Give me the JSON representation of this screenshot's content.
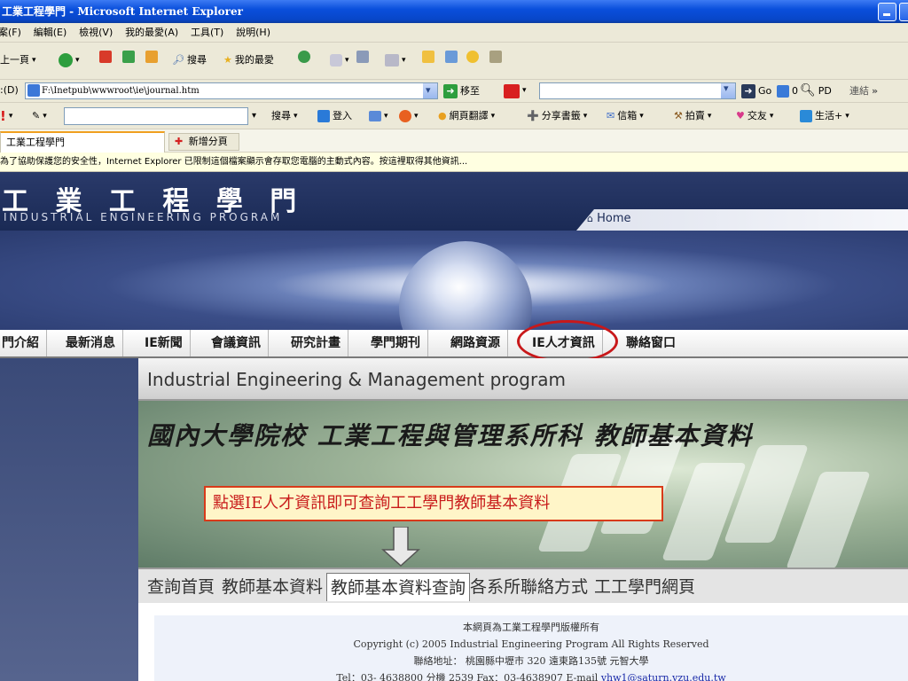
{
  "window": {
    "title": "工業工程學門 - Microsoft Internet Explorer"
  },
  "menu": [
    "案(F)",
    "編輯(E)",
    "檢視(V)",
    "我的最愛(A)",
    "工具(T)",
    "說明(H)"
  ],
  "toolbar": {
    "back": "上一頁",
    "search": "搜尋",
    "favorites": "我的最愛"
  },
  "address": {
    "label": ":(D)",
    "url": "F:\\Inetpub\\wwwroot\\ie\\journal.htm",
    "go": "移至",
    "go2": "Go",
    "count": "0",
    "pd": "PD",
    "links": "連結"
  },
  "yahoo_toolbar": {
    "search_btn": "搜尋",
    "login": "登入",
    "translate": "網頁翻譯",
    "bookmarks": "分享書籤",
    "mail": "信箱",
    "auction": "拍賣",
    "friends": "交友",
    "life": "生活+"
  },
  "tabs": {
    "active": "工業工程學門",
    "new_tab": "新增分頁"
  },
  "infobar": "為了協助保護您的安全性，Internet Explorer 已限制這個檔案顯示會存取您電腦的主動式內容。按這裡取得其他資訊...",
  "site": {
    "title": "工 業 工 程 學 門",
    "subtitle": "INDUSTRIAL ENGINEERING PROGRAM",
    "home": "Home"
  },
  "nav": [
    "門介紹",
    "最新消息",
    "IE新聞",
    "會議資訊",
    "研究計畫",
    "學門期刊",
    "網路資源",
    "IE人才資訊",
    "聯絡窗口"
  ],
  "content": {
    "heading": "Industrial Engineering & Management program",
    "hero_title": "國內大學院校 工業工程與管理系所科 教師基本資料",
    "callout": "點選IE人才資訊即可查詢工工學門教師基本資料",
    "subnav": [
      "查詢首頁",
      "教師基本資料",
      "教師基本資料查詢",
      "各系所聯絡方式",
      "工工學門網頁"
    ]
  },
  "footer": {
    "line1": "本網頁為工業工程學門版權所有",
    "line2": "Copyright (c) 2005 Industrial Engineering Program All Rights Reserved",
    "line3": "聯絡地址： 桃園縣中壢市 320 遠東路135號 元智大學",
    "line4": "Tel：03- 4638800 分機 2539 Fax：03-4638907 E-mail",
    "email": "yhw1@saturn.yzu.edu.tw"
  }
}
